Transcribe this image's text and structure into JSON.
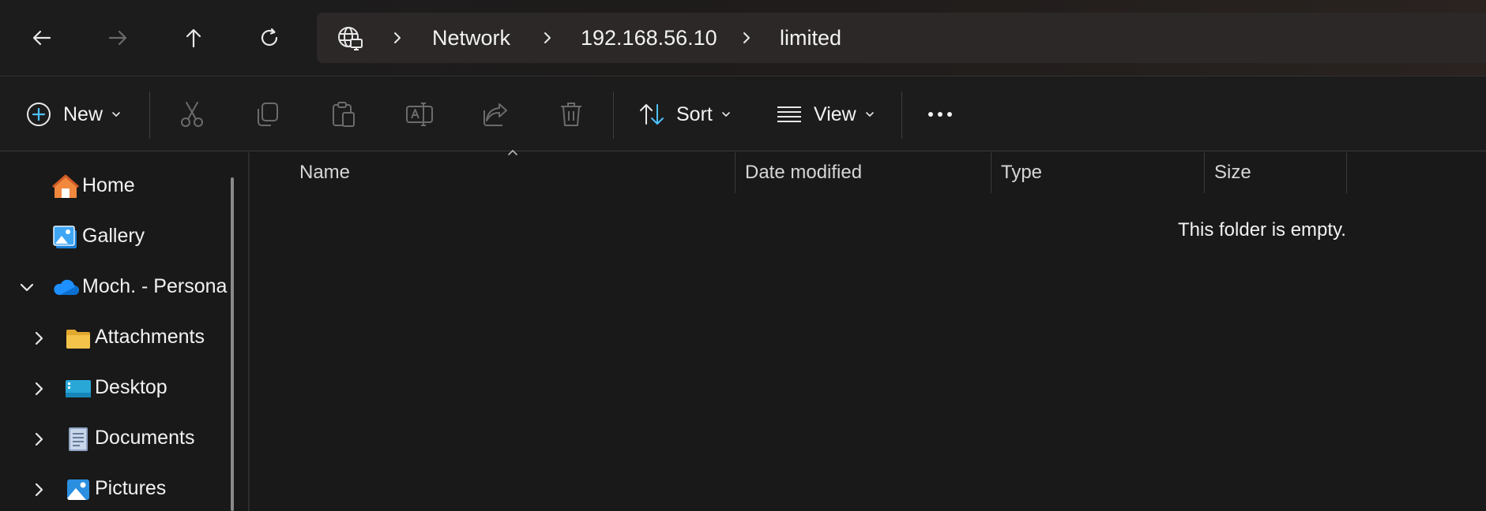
{
  "navigation": {
    "back_icon": "arrow-left-icon",
    "forward_icon": "arrow-right-icon",
    "up_icon": "arrow-up-icon",
    "refresh_icon": "refresh-icon"
  },
  "address_bar": {
    "root_icon": "network-globe-icon",
    "breadcrumbs": [
      "Network",
      "192.168.56.10",
      "limited"
    ]
  },
  "command_bar": {
    "new_label": "New",
    "sort_label": "Sort",
    "view_label": "View",
    "disabled_actions": [
      "cut-icon",
      "copy-icon",
      "paste-icon",
      "rename-icon",
      "share-icon",
      "delete-icon"
    ],
    "more_icon": "more-icon"
  },
  "sidebar": {
    "items": [
      {
        "label": "Home",
        "icon": "home-icon"
      },
      {
        "label": "Gallery",
        "icon": "gallery-icon"
      },
      {
        "label": "Moch. - Persona",
        "icon": "onedrive-cloud-icon",
        "expanded": true
      },
      {
        "label": "Attachments",
        "icon": "folder-icon"
      },
      {
        "label": "Desktop",
        "icon": "desktop-icon"
      },
      {
        "label": "Documents",
        "icon": "documents-icon"
      },
      {
        "label": "Pictures",
        "icon": "pictures-icon"
      }
    ]
  },
  "file_list": {
    "columns": [
      "Name",
      "Date modified",
      "Type",
      "Size"
    ],
    "sorted_column": "Name",
    "empty_message": "This folder is empty."
  },
  "colors": {
    "background": "#191919",
    "accent_blue": "#4cc2ff",
    "folder_yellow": "#f4c34a",
    "home_orange": "#f0883e"
  }
}
